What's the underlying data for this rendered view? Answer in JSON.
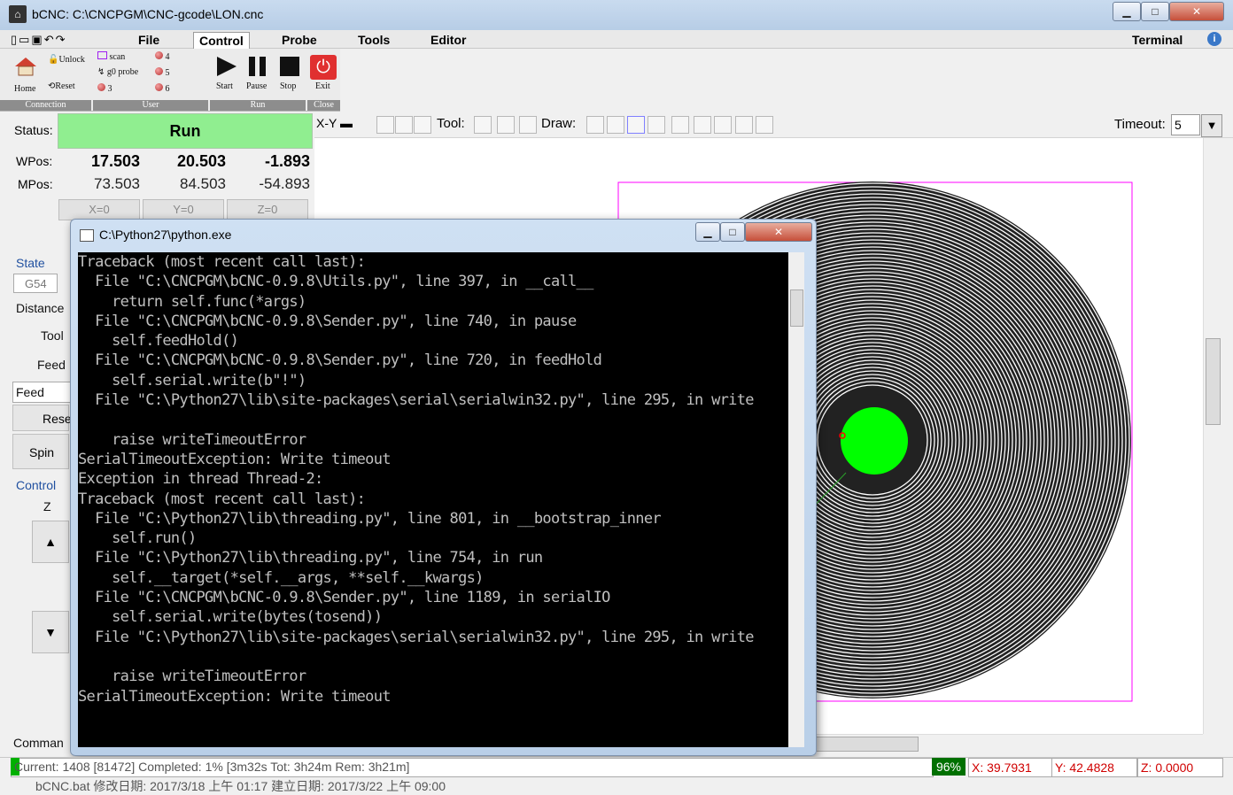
{
  "window": {
    "title": "bCNC: C:\\CNCPGM\\CNC-gcode\\LON.cnc",
    "minimize": "▁",
    "maximize": "□",
    "close": "✕"
  },
  "menu": {
    "tabs": [
      "File",
      "Control",
      "Probe",
      "Tools",
      "Editor"
    ],
    "terminal": "Terminal"
  },
  "ribbon": {
    "home": "Home",
    "unlock": "Unlock",
    "reset": "Reset",
    "scan": "scan",
    "g0probe": "g0 probe",
    "user3": "3",
    "user4": "4",
    "user5": "5",
    "user6": "6",
    "start": "Start",
    "pause": "Pause",
    "stop": "Stop",
    "exit": "Exit",
    "groups": {
      "connection": "Connection",
      "user": "User",
      "run": "Run",
      "close": "Close"
    }
  },
  "dro": {
    "status_label": "Status:",
    "status_value": "Run",
    "wpos_label": "WPos:",
    "mpos_label": "MPos:",
    "wpos": {
      "x": "17.503",
      "y": "20.503",
      "z": "-1.893"
    },
    "mpos": {
      "x": "73.503",
      "y": "84.503",
      "z": "-54.893"
    },
    "zero": {
      "x": "X=0",
      "y": "Y=0",
      "z": "Z=0"
    }
  },
  "state": {
    "title": "State",
    "wcs": "G54",
    "distance": "Distance",
    "tool": "Tool",
    "feed": "Feed",
    "feed_field": "Feed",
    "reset": "Rese",
    "spindle": "Spin"
  },
  "control": {
    "title": "Control",
    "z": "Z",
    "up": "▲",
    "down": "▼"
  },
  "command_label": "Comman",
  "canvas_toolbar": {
    "view": "X-Y",
    "tool_label": "Tool:",
    "draw_label": "Draw:",
    "timeout_label": "Timeout:",
    "timeout_value": "5"
  },
  "console": {
    "title": "C:\\Python27\\python.exe",
    "lines": [
      "Traceback (most recent call last):",
      "  File \"C:\\CNCPGM\\bCNC-0.9.8\\Utils.py\", line 397, in __call__",
      "    return self.func(*args)",
      "  File \"C:\\CNCPGM\\bCNC-0.9.8\\Sender.py\", line 740, in pause",
      "    self.feedHold()",
      "  File \"C:\\CNCPGM\\bCNC-0.9.8\\Sender.py\", line 720, in feedHold",
      "    self.serial.write(b\"!\")",
      "  File \"C:\\Python27\\lib\\site-packages\\serial\\serialwin32.py\", line 295, in write",
      "",
      "    raise writeTimeoutError",
      "SerialTimeoutException: Write timeout",
      "Exception in thread Thread-2:",
      "Traceback (most recent call last):",
      "  File \"C:\\Python27\\lib\\threading.py\", line 801, in __bootstrap_inner",
      "    self.run()",
      "  File \"C:\\Python27\\lib\\threading.py\", line 754, in run",
      "    self.__target(*self.__args, **self.__kwargs)",
      "  File \"C:\\CNCPGM\\bCNC-0.9.8\\Sender.py\", line 1189, in serialIO",
      "    self.serial.write(bytes(tosend))",
      "  File \"C:\\Python27\\lib\\site-packages\\serial\\serialwin32.py\", line 295, in write",
      "",
      "    raise writeTimeoutError",
      "SerialTimeoutException: Write timeout"
    ]
  },
  "statusbar": {
    "progress_text": "Current: 1408 [81472]  Completed: 1% [3m32s Tot: 3h24m Rem: 3h21m]",
    "progress_fraction": 0.01,
    "percent": "96%",
    "x": "X: 39.7931",
    "y": "Y: 42.4828",
    "z": "Z: 0.0000"
  },
  "behind_window_text": "bCNC.bat        修改日期: 2017/3/18 上午 01:17    建立日期: 2017/3/22 上午 09:00",
  "colors": {
    "run_green": "#90ee90",
    "spot_green": "#00ff00",
    "margin_magenta": "#ff00ff",
    "coord_red": "#d00000"
  }
}
